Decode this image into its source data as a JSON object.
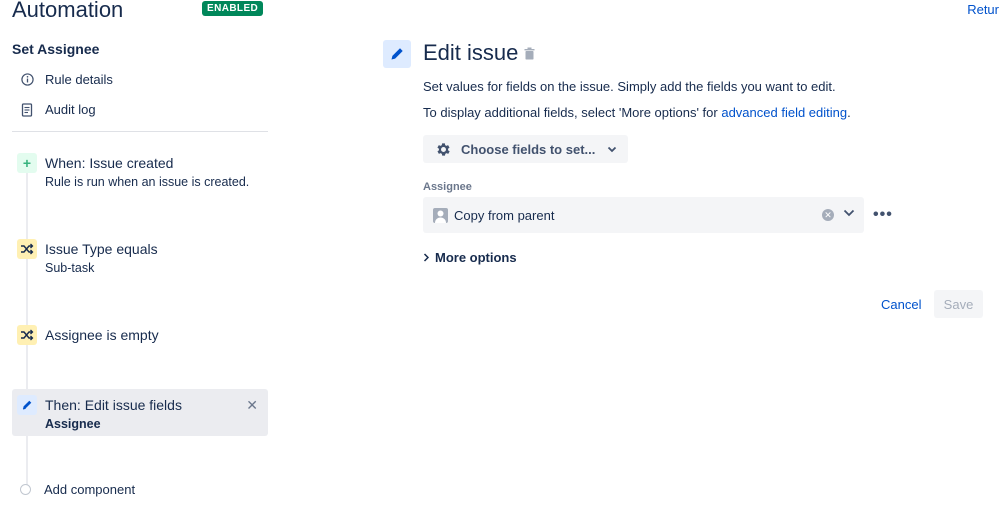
{
  "header": {
    "title": "Automation",
    "status": "ENABLED",
    "return_link": "Retur"
  },
  "sidebar": {
    "rule_name": "Set Assignee",
    "nav": [
      {
        "label": "Rule details",
        "icon": "info-icon"
      },
      {
        "label": "Audit log",
        "icon": "document-icon"
      }
    ],
    "steps": [
      {
        "title": "When: Issue created",
        "subtitle": "Rule is run when an issue is created.",
        "icon": "plus-icon"
      },
      {
        "title": "Issue Type equals",
        "subtitle": "Sub-task",
        "icon": "shuffle-icon"
      },
      {
        "title": "Assignee is empty",
        "subtitle": "",
        "icon": "shuffle-icon"
      },
      {
        "title": "Then: Edit issue fields",
        "subtitle": "Assignee",
        "icon": "pencil-icon"
      }
    ],
    "add_component": "Add component"
  },
  "main": {
    "title": "Edit issue",
    "description1": "Set values for fields on the issue. Simply add the fields you want to edit.",
    "description2_prefix": "To display additional fields, select 'More options' for ",
    "description2_link": "advanced field editing",
    "description2_suffix": ".",
    "choose_fields": "Choose fields to set...",
    "field_label": "Assignee",
    "field_value": "Copy from parent",
    "more_options": "More options",
    "cancel": "Cancel",
    "save": "Save"
  },
  "colors": {
    "accent": "#0052cc",
    "enabled": "#00875a",
    "text": "#172b4d",
    "trigger_bg": "#e3fcef",
    "condition_bg": "#fff0b3",
    "action_bg": "#deebff"
  }
}
